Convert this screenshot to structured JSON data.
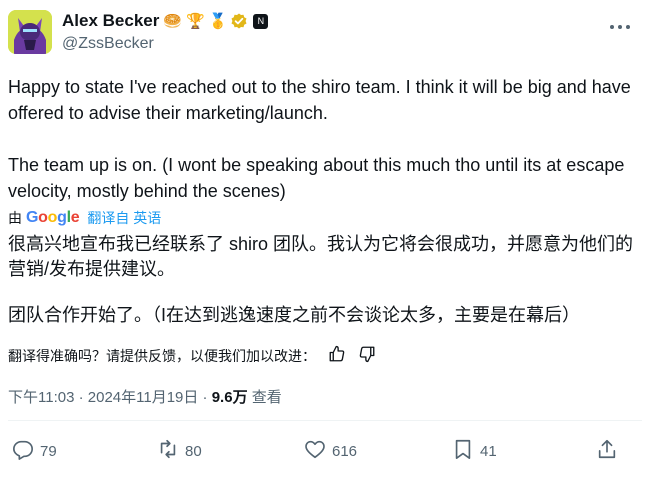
{
  "author": {
    "name": "Alex Becker",
    "handle": "@ZssBecker",
    "badges": [
      "🥯",
      "🏆",
      "🥇"
    ],
    "affiliate_badge": "N"
  },
  "tweet": {
    "paragraph1": "Happy to state I've reached out to the shiro team. I think it will be big and have offered to advise their marketing/launch.",
    "paragraph2": "The team up is on. (I wont be speaking about this much tho until its at escape velocity, mostly behind the scenes)"
  },
  "translation": {
    "by_label": "由",
    "provider": "Google",
    "action_label": "翻译自 英语",
    "paragraph1": "很高兴地宣布我已经联系了 shiro 团队。我认为它将会很成功，并愿意为他们的营销/发布提供建议。",
    "paragraph2": "团队合作开始了。（I在达到逃逸速度之前不会谈论太多，主要是在幕后）",
    "feedback_question": "翻译得准确吗？请提供反馈，以便我们加以改进："
  },
  "meta": {
    "time": "下午11:03 · 2024年11月19日 · ",
    "views_count": "9.6万",
    "views_label": " 查看"
  },
  "actions": {
    "replies": "79",
    "reposts": "80",
    "likes": "616",
    "bookmarks": "41"
  },
  "colors": {
    "link": "#1d9bf0",
    "secondary_text": "#536471",
    "verified": "#e2b719"
  }
}
